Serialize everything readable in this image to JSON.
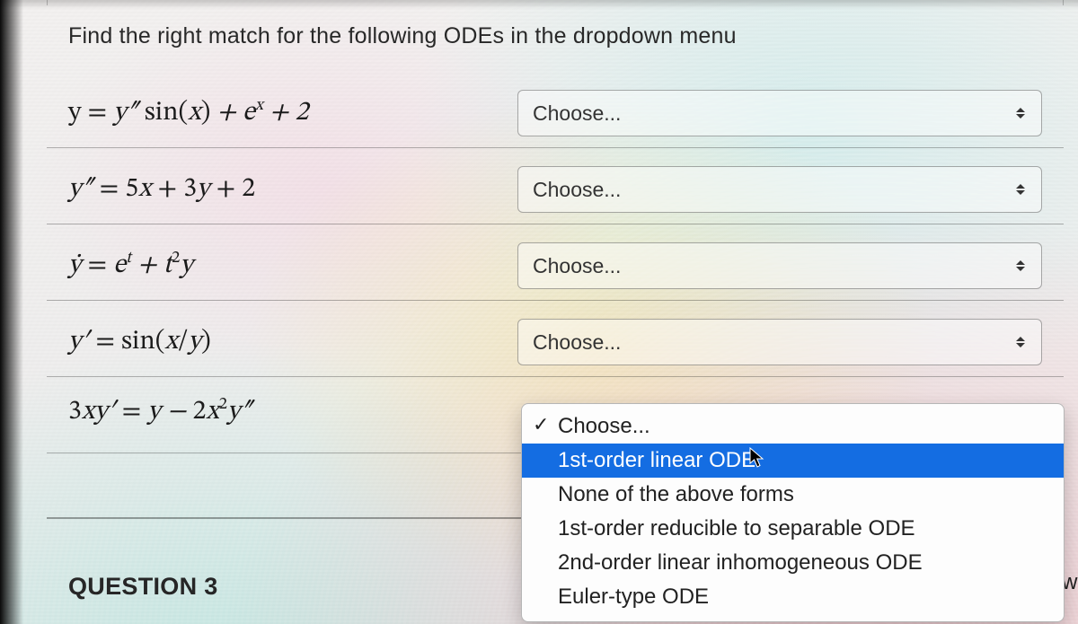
{
  "prompt": "Find the right match for the following ODEs in the dropdown menu",
  "rows": [
    {
      "equation_html": "<span class='up'>y = </span>y″ <span class='up'>sin(</span>x<span class='up'>)</span> + e<sup>x</sup> + 2",
      "select_label": "Choose..."
    },
    {
      "equation_html": "y″ <span class='up'>= 5</span>x <span class='up'>+ 3</span>y <span class='up'>+ 2</span>",
      "select_label": "Choose..."
    },
    {
      "equation_html": "ẏ <span class='up'>= </span>e<sup>t</sup> + t<sup><span class='up'>2</span></sup>y",
      "select_label": "Choose..."
    },
    {
      "equation_html": "y′ <span class='up'>= sin(</span>x<span class='up'>/</span>y<span class='up'>)</span>",
      "select_label": "Choose..."
    },
    {
      "equation_html": "<span class='up'>3</span>xy′ <span class='up'>= </span>y − <span class='up'>2</span>x<sup><span class='up'>2</span></sup>y″",
      "select_label": "Choose..."
    }
  ],
  "dropdown": {
    "selected": "Choose...",
    "highlighted": "1st-order linear ODE",
    "options": [
      "Choose...",
      "1st-order linear ODE",
      "None of the above forms",
      "1st-order reducible to separable ODE",
      "2nd-order linear inhomogeneous ODE",
      "Euler-type ODE"
    ]
  },
  "next_question_label": "QUESTION 3",
  "peek_text": "nsw"
}
